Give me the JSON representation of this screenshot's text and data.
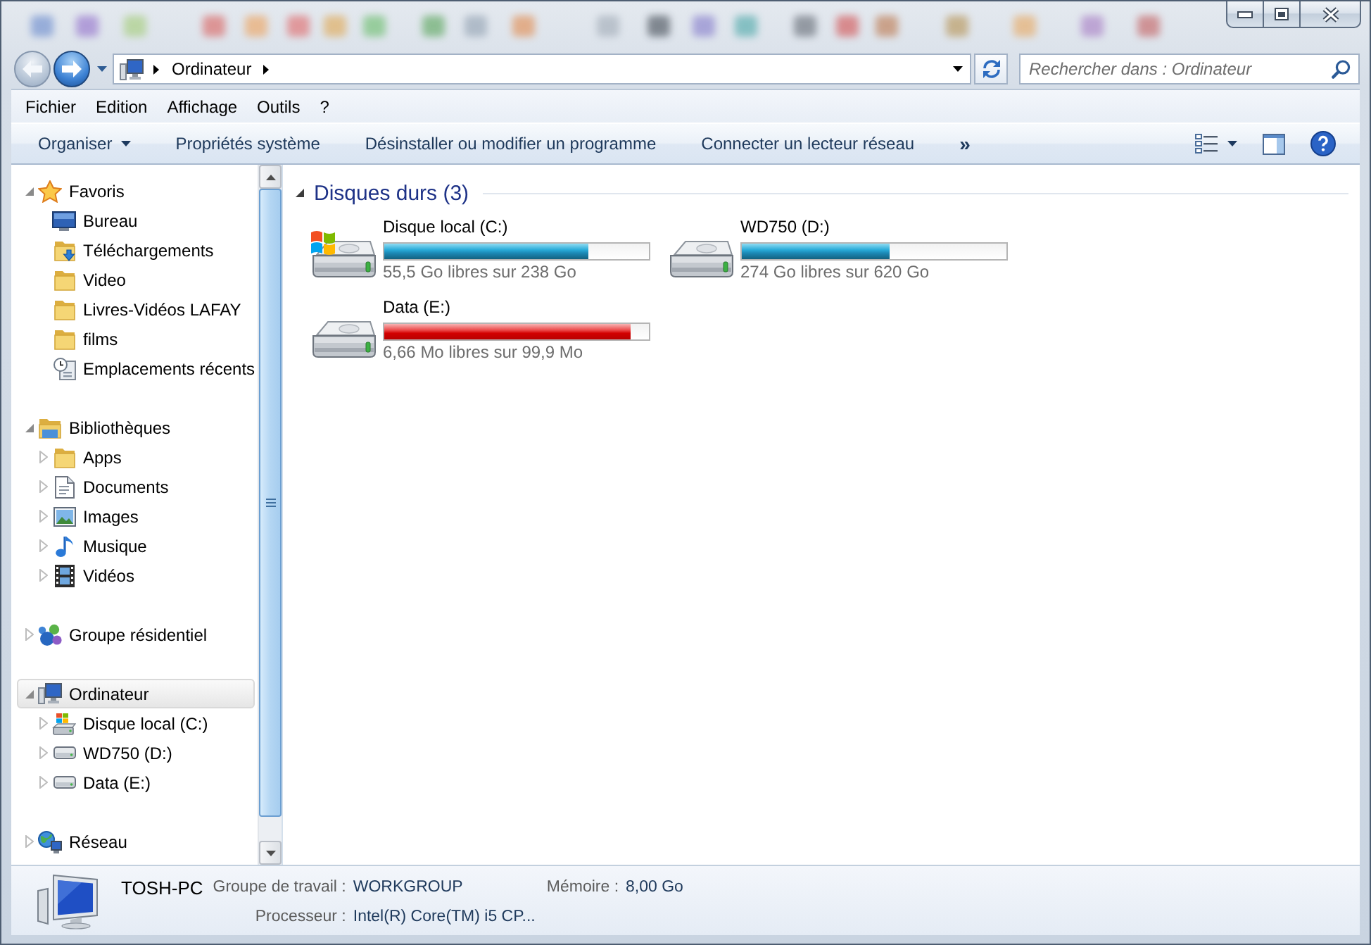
{
  "navigation": {
    "back": {
      "disabled": true
    },
    "forward": {
      "disabled": false
    }
  },
  "address_bar": {
    "segments": [
      {
        "label": "Ordinateur"
      }
    ]
  },
  "search": {
    "placeholder": "Rechercher dans : Ordinateur"
  },
  "menu_bar": {
    "items": [
      "Fichier",
      "Edition",
      "Affichage",
      "Outils",
      "?"
    ]
  },
  "toolbar": {
    "commands": [
      {
        "label": "Organiser",
        "kind": "menu"
      },
      {
        "label": "Propriétés système",
        "kind": "command"
      },
      {
        "label": "Désinstaller ou modifier un programme",
        "kind": "command"
      },
      {
        "label": "Connecter un lecteur réseau",
        "kind": "command"
      },
      {
        "label": "»",
        "kind": "overflow"
      }
    ]
  },
  "sidebar": {
    "groups": [
      {
        "label": "Favoris",
        "kind": "favorites",
        "expanded": true,
        "selected": false,
        "children": [
          {
            "label": "Bureau",
            "kind": "desktop",
            "selected": false
          },
          {
            "label": "Téléchargements",
            "kind": "downloads",
            "selected": false
          },
          {
            "label": "Video",
            "kind": "folder",
            "selected": false
          },
          {
            "label": "Livres-Vidéos LAFAY",
            "kind": "folder",
            "selected": false
          },
          {
            "label": "films",
            "kind": "folder",
            "selected": false
          },
          {
            "label": "Emplacements récents",
            "kind": "recent",
            "selected": false
          }
        ]
      },
      {
        "label": "Bibliothèques",
        "kind": "libraries",
        "expanded": true,
        "selected": false,
        "children": [
          {
            "label": "Apps",
            "kind": "folder",
            "expanded": false,
            "selected": false
          },
          {
            "label": "Documents",
            "kind": "documents",
            "expanded": false,
            "selected": false
          },
          {
            "label": "Images",
            "kind": "pictures",
            "expanded": false,
            "selected": false
          },
          {
            "label": "Musique",
            "kind": "music",
            "expanded": false,
            "selected": false
          },
          {
            "label": "Vidéos",
            "kind": "videos",
            "expanded": false,
            "selected": false
          }
        ]
      },
      {
        "label": "Groupe résidentiel",
        "kind": "homegroup",
        "expanded": false,
        "selected": false
      },
      {
        "label": "Ordinateur",
        "kind": "computer",
        "expanded": true,
        "selected": true,
        "children": [
          {
            "label": "Disque local (C:)",
            "kind": "system-drive",
            "expanded": false,
            "selected": false
          },
          {
            "label": "WD750 (D:)",
            "kind": "drive",
            "expanded": false,
            "selected": false
          },
          {
            "label": "Data (E:)",
            "kind": "drive",
            "expanded": false,
            "selected": false
          }
        ]
      },
      {
        "label": "Réseau",
        "kind": "network",
        "expanded": false,
        "selected": false
      }
    ]
  },
  "content": {
    "groups": [
      {
        "title": "Disques durs (3)",
        "expanded": true,
        "items": [
          {
            "name": "Disque local (C:)",
            "kind": "system-drive",
            "level": 0.77,
            "low_space": false,
            "info": "55,5 Go libres sur 238 Go"
          },
          {
            "name": "WD750 (D:)",
            "kind": "drive",
            "level": 0.56,
            "low_space": false,
            "info": "274 Go libres sur 620 Go"
          },
          {
            "name": "Data (E:)",
            "kind": "drive",
            "level": 0.93,
            "low_space": true,
            "info": "6,66 Mo libres sur 99,9 Mo"
          }
        ]
      }
    ]
  },
  "details_pane": {
    "name": "TOSH-PC",
    "rows": [
      [
        {
          "label": "Groupe de travail :",
          "value": "WORKGROUP"
        },
        {
          "label": "Mémoire :",
          "value": "8,00 Go"
        }
      ],
      [
        {
          "label": "Processeur :",
          "value": "Intel(R) Core(TM) i5 CP..."
        }
      ]
    ]
  }
}
